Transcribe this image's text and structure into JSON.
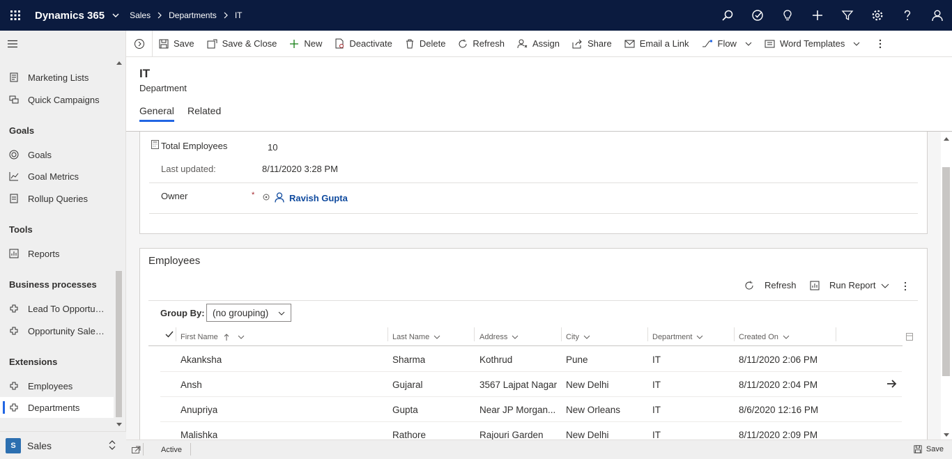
{
  "topbar": {
    "app_name": "Dynamics 365",
    "breadcrumb": [
      "Sales",
      "Departments",
      "IT"
    ],
    "icons": [
      "search-icon",
      "task-icon",
      "lightbulb-icon",
      "plus-icon",
      "filter-icon",
      "settings-icon",
      "help-icon",
      "user-icon"
    ]
  },
  "sidebar": {
    "items": [
      {
        "label": "Marketing Lists",
        "icon": "list-icon"
      },
      {
        "label": "Quick Campaigns",
        "icon": "campaign-icon"
      },
      {
        "label": "Goals",
        "icon": "target-icon"
      },
      {
        "label": "Goal Metrics",
        "icon": "chart-icon"
      },
      {
        "label": "Rollup Queries",
        "icon": "document-icon"
      },
      {
        "label": "Reports",
        "icon": "report-icon"
      },
      {
        "label": "Lead To Opportun...",
        "icon": "process-icon"
      },
      {
        "label": "Opportunity Sales...",
        "icon": "process-icon"
      },
      {
        "label": "Employees",
        "icon": "puzzle-icon"
      },
      {
        "label": "Departments",
        "icon": "puzzle-icon"
      }
    ],
    "groups": {
      "goals": "Goals",
      "tools": "Tools",
      "business": "Business processes",
      "extensions": "Extensions"
    },
    "area": {
      "badge": "S",
      "label": "Sales"
    }
  },
  "commands": [
    "Save",
    "Save & Close",
    "New",
    "Deactivate",
    "Delete",
    "Refresh",
    "Assign",
    "Share",
    "Email a Link",
    "Flow",
    "Word Templates"
  ],
  "record": {
    "title": "IT",
    "entity": "Department",
    "tabs": [
      "General",
      "Related"
    ]
  },
  "form": {
    "total_employees_label": "Total Employees",
    "total_employees_value": "10",
    "last_updated_label": "Last updated:",
    "last_updated_value": "8/11/2020 3:28 PM",
    "owner_label": "Owner",
    "owner_required": "*",
    "owner_value": "Ravish Gupta"
  },
  "subgrid": {
    "title": "Employees",
    "refresh_label": "Refresh",
    "run_report_label": "Run Report",
    "group_by_label": "Group By:",
    "group_by_value": "(no grouping)",
    "columns": [
      "First Name",
      "Last Name",
      "Address",
      "City",
      "Department",
      "Created On"
    ],
    "rows": [
      [
        "Akanksha",
        "Sharma",
        "Kothrud",
        "Pune",
        "IT",
        "8/11/2020 2:06 PM"
      ],
      [
        "Ansh",
        "Gujaral",
        "3567 Lajpat Nagar",
        "New Delhi",
        "IT",
        "8/11/2020 2:04 PM"
      ],
      [
        "Anupriya",
        "Gupta",
        "Near JP Morgan...",
        "New Orleans",
        "IT",
        "8/6/2020 12:16 PM"
      ],
      [
        "Malishka",
        "Rathore",
        "Rajouri Garden",
        "New Delhi",
        "IT",
        "8/11/2020 2:09 PM"
      ]
    ]
  },
  "status": {
    "state": "Active",
    "save_label": "Save"
  },
  "colors": {
    "nav": "#0b1b3f",
    "accent": "#2266e3",
    "link": "#0f4a9e"
  }
}
